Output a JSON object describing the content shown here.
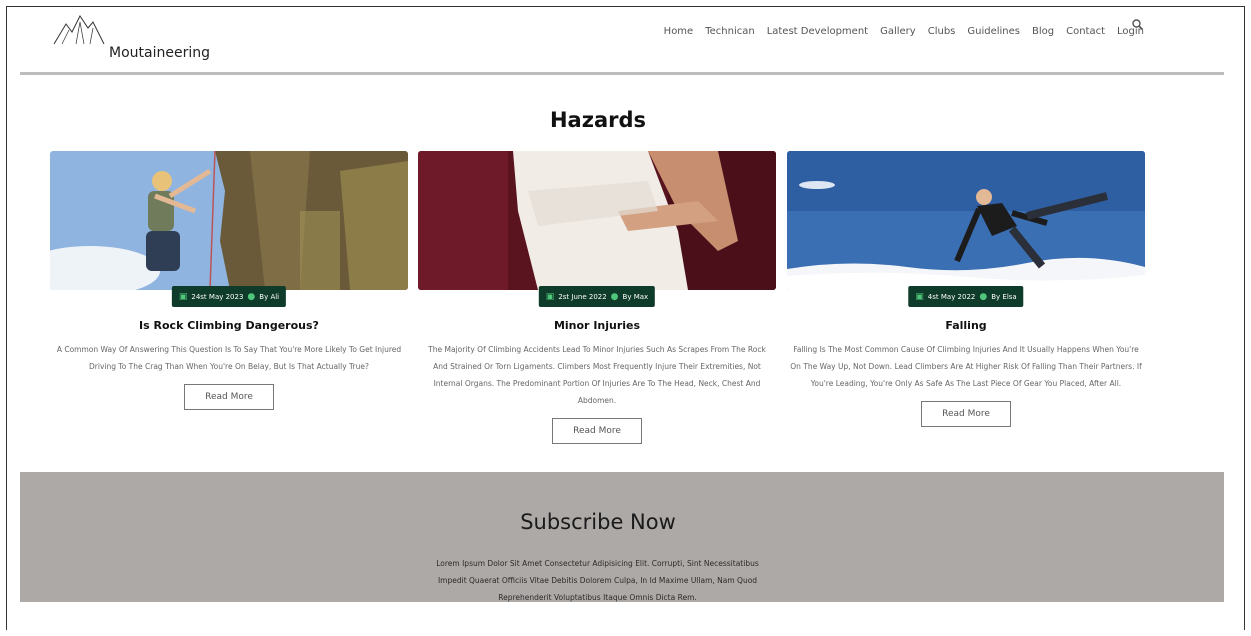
{
  "header": {
    "brand": "Moutaineering",
    "nav": [
      "Home",
      "Technican",
      "Latest Development",
      "Gallery",
      "Clubs",
      "Guidelines",
      "Blog",
      "Contact",
      "Login"
    ]
  },
  "hazards": {
    "title": "Hazards",
    "cards": [
      {
        "date": "24st May 2023",
        "author": "By Ali",
        "title": "Is Rock Climbing Dangerous?",
        "text": "A Common Way Of Answering This Question Is To Say That You're More Likely To Get Injured Driving To The Crag Than When You're On Belay, But Is That Actually True?",
        "button": "Read More"
      },
      {
        "date": "2st June 2022",
        "author": "By Max",
        "title": "Minor Injuries",
        "text": "The Majority Of Climbing Accidents Lead To Minor Injuries Such As Scrapes From The Rock And Strained Or Torn Ligaments. Climbers Most Frequently Injure Their Extremities, Not Internal Organs. The Predominant Portion Of Injuries Are To The Head, Neck, Chest And Abdomen.",
        "button": "Read More"
      },
      {
        "date": "4st May 2022",
        "author": "By Elsa",
        "title": "Falling",
        "text": "Falling Is The Most Common Cause Of Climbing Injuries And It Usually Happens When You're On The Way Up, Not Down. Lead Climbers Are At Higher Risk Of Falling Than Their Partners. If You're Leading, You're Only As Safe As The Last Piece Of Gear You Placed, After All.",
        "button": "Read More"
      }
    ]
  },
  "subscribe": {
    "title": "Subscribe Now",
    "text": "Lorem Ipsum Dolor Sit Amet Consectetur Adipisicing Elit. Corrupti, Sint Necessitatibus Impedit Quaerat Officiis Vitae Debitis Dolorem Culpa, In Id Maxime Ullam, Nam Quod Reprehenderit Voluptatibus Itaque Omnis Dicta Rem."
  }
}
